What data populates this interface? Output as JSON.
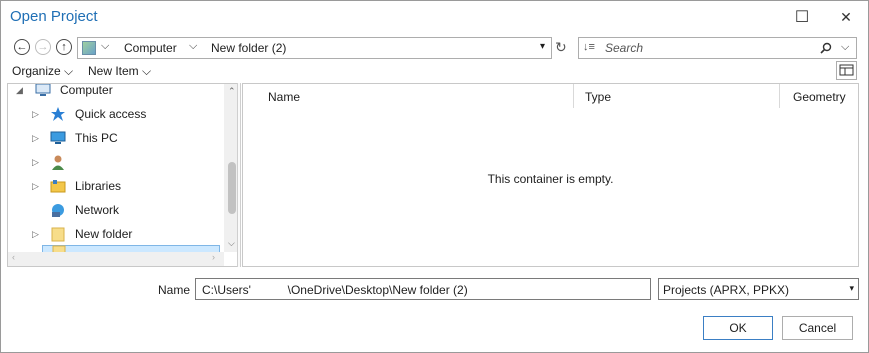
{
  "window": {
    "title": "Open Project",
    "maximize_glyph": "☐",
    "close_glyph": "✕"
  },
  "nav": {
    "back_glyph": "←",
    "forward_glyph": "→",
    "up_glyph": "↑",
    "location_chevron": "⌵",
    "crumbs": [
      "Computer",
      "New folder (2)"
    ],
    "crumb_chevron": "⌵",
    "dropdown_glyph": "▾",
    "refresh_glyph": "↻"
  },
  "search": {
    "placeholder": "Search",
    "icon": "search-icon",
    "chevron": "⌵",
    "sort_glyph": "↓≡"
  },
  "toolbar": {
    "organize": "Organize",
    "new_item": "New Item",
    "chevron": "⌵",
    "view_icon": "view-layout-icon"
  },
  "tree": {
    "expand_glyph": "▷",
    "collapse_glyph": "◢",
    "items": [
      {
        "label": "Computer",
        "icon": "computer-icon"
      },
      {
        "label": "Quick access",
        "icon": "star-icon"
      },
      {
        "label": "This PC",
        "icon": "monitor-icon"
      },
      {
        "label": "",
        "icon": "user-icon"
      },
      {
        "label": "Libraries",
        "icon": "library-icon"
      },
      {
        "label": "Network",
        "icon": "network-icon"
      },
      {
        "label": "New folder",
        "icon": "folder-icon"
      },
      {
        "label": "",
        "icon": "folder-icon"
      }
    ]
  },
  "list": {
    "columns": [
      "Name",
      "Type",
      "Geometry"
    ],
    "empty_text": "This container is empty."
  },
  "footer": {
    "name_label": "Name",
    "name_value": "C:\\Users'           \\OneDrive\\Desktop\\New folder (2)",
    "type_value": "Projects (APRX, PPKX)",
    "type_arrow": "▾",
    "ok_label": "OK",
    "cancel_label": "Cancel"
  },
  "colors": {
    "title": "#1f6fb5",
    "selection": "#cce8ff",
    "accent": "#3b7fc4"
  }
}
